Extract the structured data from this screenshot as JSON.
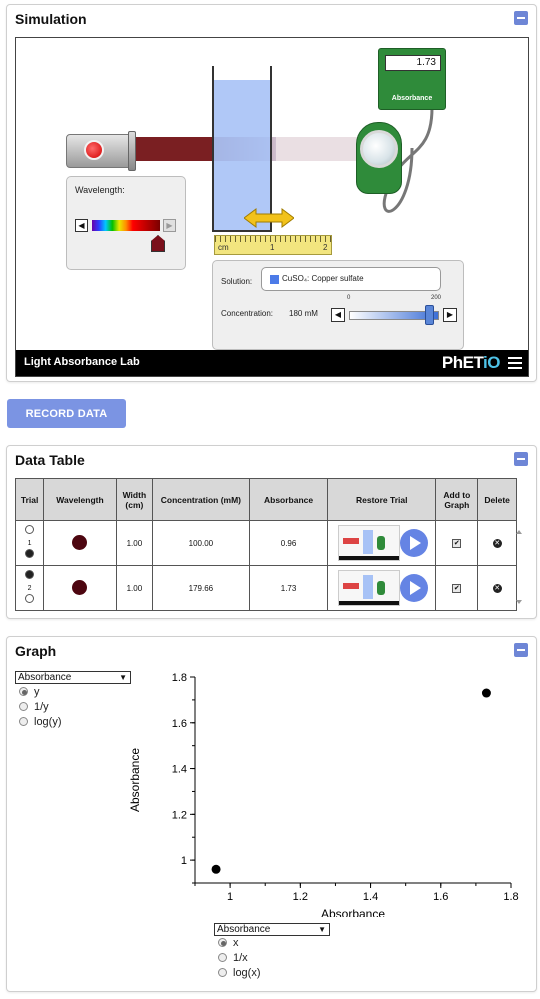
{
  "simulation": {
    "title": "Simulation",
    "footer_title": "Light Absorbance Lab",
    "logo_text_a": "PhET",
    "logo_text_b": "iO",
    "wavelength_label": "Wavelength:",
    "ruler": {
      "unit": "cm",
      "tick1": "1",
      "tick2": "2"
    },
    "meter": {
      "value": "1.73",
      "label": "Absorbance"
    },
    "solution_label": "Solution:",
    "solution_name": "CuSO₄: Copper sulfate",
    "concentration_label": "Concentration:",
    "concentration_value": "180 mM",
    "concentration_min": "0",
    "concentration_max": "200",
    "concentration_fraction": 0.9,
    "colors": {
      "solution": "#a7c2f6",
      "beam": "#7a1f22",
      "detector": "#2f8b3a"
    }
  },
  "record_button": "RECORD DATA",
  "data_table": {
    "title": "Data Table",
    "headers": [
      "Trial",
      "Wavelength",
      "Width (cm)",
      "Concentration (mM)",
      "Absorbance",
      "Restore Trial",
      "Add to Graph",
      "Delete"
    ],
    "rows": [
      {
        "trial": "1",
        "width": "1.00",
        "concentration": "100.00",
        "absorbance": "0.96"
      },
      {
        "trial": "2",
        "width": "1.00",
        "concentration": "179.66",
        "absorbance": "1.73"
      }
    ]
  },
  "graph": {
    "title": "Graph",
    "y_select": "Absorbance",
    "y_options": [
      "y",
      "1/y",
      "log(y)"
    ],
    "x_select": "Absorbance",
    "x_options": [
      "x",
      "1/x",
      "log(x)"
    ]
  },
  "chart_data": {
    "type": "scatter",
    "title": "",
    "xlabel": "Absorbance",
    "ylabel": "Absorbance",
    "xlim": [
      0.9,
      1.8
    ],
    "ylim": [
      0.9,
      1.8
    ],
    "x_ticks": [
      "1",
      "1.2",
      "1.4",
      "1.6",
      "1.8"
    ],
    "y_ticks": [
      "1",
      "1.2",
      "1.4",
      "1.6",
      "1.8"
    ],
    "points": [
      {
        "x": 0.96,
        "y": 0.96
      },
      {
        "x": 1.73,
        "y": 1.73
      }
    ]
  }
}
